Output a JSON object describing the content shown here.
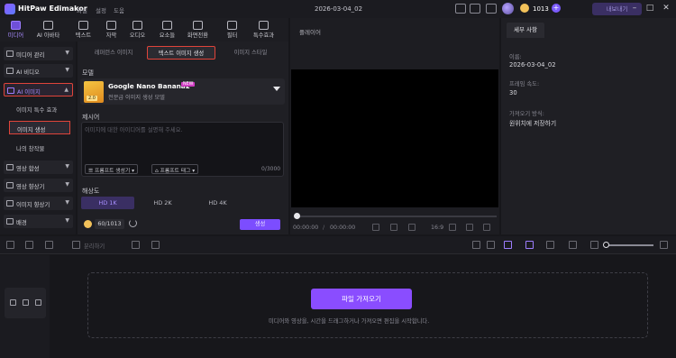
{
  "app": {
    "name": "HitPaw Edimakor",
    "menu": [
      "파일",
      "설정",
      "도움"
    ],
    "project_title": "2026-03-04_02",
    "coins": "1013",
    "export_label": "내보내기"
  },
  "categories": [
    {
      "label": "미디어",
      "icon": "media-icon",
      "active": true
    },
    {
      "label": "AI 아바타",
      "icon": "avatar-icon"
    },
    {
      "label": "텍스트",
      "icon": "text-icon"
    },
    {
      "label": "자막",
      "icon": "subtitle-icon"
    },
    {
      "label": "오디오",
      "icon": "audio-icon"
    },
    {
      "label": "요소들",
      "icon": "elements-icon"
    },
    {
      "label": "화면전환",
      "icon": "transition-icon"
    },
    {
      "label": "필터",
      "icon": "filter-icon"
    },
    {
      "label": "특수효과",
      "icon": "effects-icon"
    }
  ],
  "sidebar": {
    "items": [
      {
        "label": "미디어 관리"
      },
      {
        "label": "AI 비디오"
      },
      {
        "label": "AI 이미지"
      }
    ],
    "sub_items": [
      {
        "label": "이미지 특수 효과"
      },
      {
        "label": "이미지 생성"
      },
      {
        "label": "나의 창작물"
      }
    ],
    "lower_items": [
      {
        "label": "영상 합성"
      },
      {
        "label": "영상 향상기"
      },
      {
        "label": "이미지 향상기"
      },
      {
        "label": "배경"
      }
    ]
  },
  "middle": {
    "tabs": [
      "레퍼런스 이미지",
      "텍스트 이미지 생성",
      "이미지 스타일"
    ],
    "model_label": "모델",
    "model": {
      "name": "Google Nano Banana2",
      "badge": "NEW",
      "version": "2.0",
      "desc": "전문급 이미지 생성 모델"
    },
    "prompt_label": "제시어",
    "prompt_placeholder": "이미지에 대한 아이디어를 설명해 주세요.",
    "prompt_buttons": [
      "프롬프트 생성기",
      "프롬프트 태그"
    ],
    "char_count": "0/3000",
    "resolution_label": "해상도",
    "resolutions": [
      "HD 1K",
      "HD 2K",
      "HD 4K"
    ],
    "credits": "60/1013",
    "generate_label": "생성"
  },
  "player": {
    "title": "플레이어",
    "time_current": "00:00:00",
    "time_sep": "/",
    "time_total": "00:00:00",
    "ratio": "16:9"
  },
  "details": {
    "tab": "세부 사항",
    "name_label": "이름:",
    "name_value": "2026-03-04_02",
    "fps_label": "프레임 속도:",
    "fps_value": "30",
    "save_label": "가져오기 방식:",
    "save_value": "원위치에 저장하기"
  },
  "timeline": {
    "split_label": "분리하기",
    "import_label": "파일 가져오기",
    "drop_hint": "미디어와 영상을, 시간을 드래그하거나 가져오면 편집을 시작합니다."
  }
}
